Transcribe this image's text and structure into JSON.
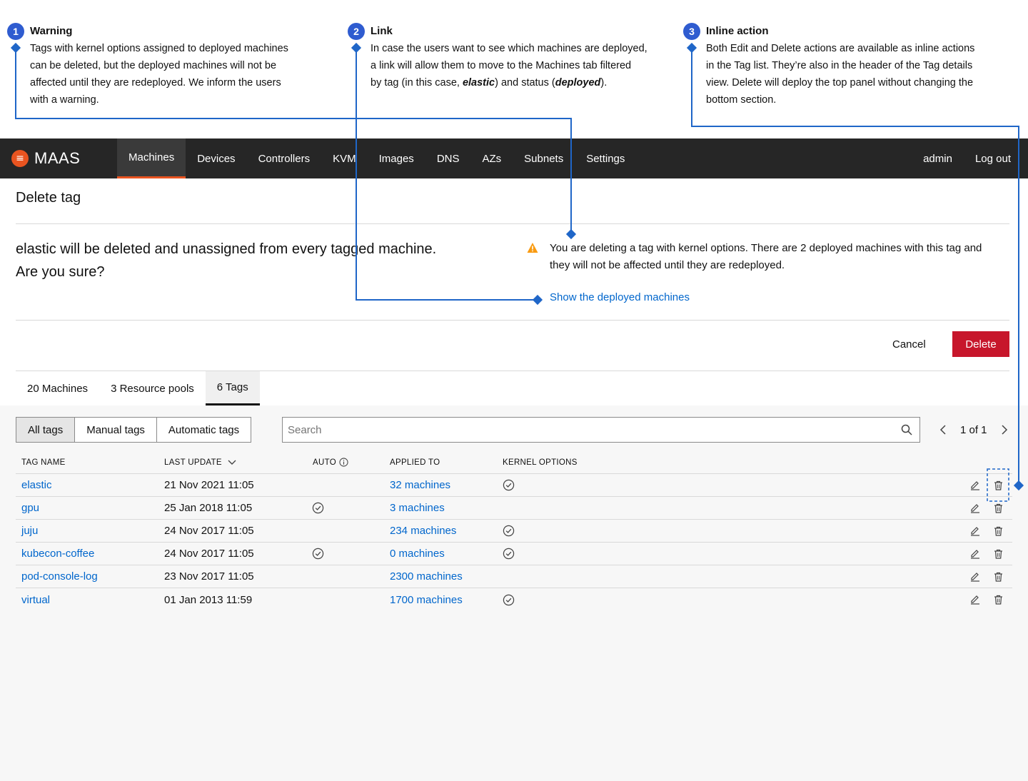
{
  "annotations": [
    {
      "number": "1",
      "title": "Warning",
      "lines": [
        "Tags with kernel options assigned to deployed machines",
        "can be deleted, but the deployed machines will not be",
        "affected until they are redeployed. We inform the users",
        "with a warning."
      ]
    },
    {
      "number": "2",
      "title": "Link",
      "line1": "In case the users want to see which machines are deployed,",
      "line2": "a link will allow them to move to the Machines tab filtered",
      "line3_pre": "by tag (in this case, ",
      "line3_em1": "elastic",
      "line3_mid": ") and status (",
      "line3_em2": "deployed",
      "line3_post": ")."
    },
    {
      "number": "3",
      "title": "Inline action",
      "lines": [
        "Both Edit and Delete actions are available as inline actions",
        "in the Tag list. They’re also in the header of the Tag details",
        "view. Delete will deploy the top panel without changing the",
        "bottom section."
      ]
    }
  ],
  "navbar": {
    "brand": "MAAS",
    "items": [
      "Machines",
      "Devices",
      "Controllers",
      "KVM",
      "Images",
      "DNS",
      "AZs",
      "Subnets",
      "Settings"
    ],
    "active": "Machines",
    "right": [
      "admin",
      "Log out"
    ]
  },
  "delete_panel": {
    "title": "Delete tag",
    "message_line1": "elastic will be deleted and unassigned from every tagged machine.",
    "message_line2": "Are you sure?",
    "warning_line1": "You are deleting a tag with kernel options. There are 2 deployed machines with this tag and",
    "warning_line2": "they will not be affected until they are redeployed.",
    "link": "Show the deployed machines",
    "cancel": "Cancel",
    "delete": "Delete"
  },
  "tabs": [
    "20 Machines",
    "3 Resource pools",
    "6 Tags"
  ],
  "active_tab": "6 Tags",
  "filters": {
    "segments": [
      "All tags",
      "Manual tags",
      "Automatic tags"
    ],
    "active": "All tags",
    "search_placeholder": "Search",
    "pagination": "1 of 1"
  },
  "table": {
    "headers": [
      "TAG NAME",
      "LAST UPDATE",
      "AUTO",
      "APPLIED TO",
      "KERNEL OPTIONS"
    ],
    "rows": [
      {
        "name": "elastic",
        "updated": "21 Nov 2021 11:05",
        "auto": false,
        "applied": "32 machines",
        "kernel": true
      },
      {
        "name": "gpu",
        "updated": "25 Jan 2018 11:05",
        "auto": true,
        "applied": "3 machines",
        "kernel": false
      },
      {
        "name": "juju",
        "updated": "24 Nov 2017 11:05",
        "auto": false,
        "applied": "234 machines",
        "kernel": true
      },
      {
        "name": "kubecon-coffee",
        "updated": "24 Nov 2017 11:05",
        "auto": true,
        "applied": "0 machines",
        "kernel": true
      },
      {
        "name": "pod-console-log",
        "updated": "23 Nov 2017 11:05",
        "auto": false,
        "applied": "2300 machines",
        "kernel": false
      },
      {
        "name": "virtual",
        "updated": "01 Jan 2013 11:59",
        "auto": false,
        "applied": "1700 machines",
        "kernel": true
      }
    ]
  },
  "colors": {
    "brand": "#e95420",
    "link": "#0066cc",
    "danger": "#c7162b",
    "annotation": "#2f5cd0",
    "warning": "#f99b11",
    "navbar": "#262626"
  }
}
